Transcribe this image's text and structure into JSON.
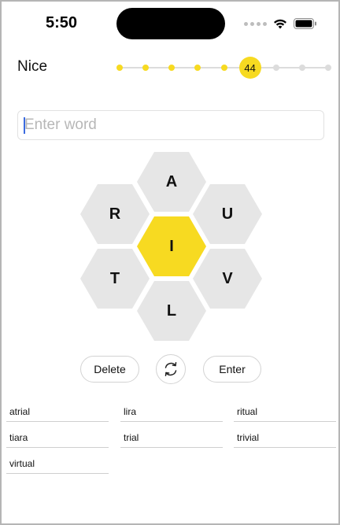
{
  "status_bar": {
    "time": "5:50"
  },
  "rank": {
    "label": "Nice",
    "score": "44",
    "filled_dots": 5,
    "empty_dots": 3,
    "colors": {
      "accent": "#f7da21",
      "inactive": "#dcdcdc"
    }
  },
  "input": {
    "value": "",
    "placeholder": "Enter word"
  },
  "hive": {
    "center": "I",
    "outer": [
      "A",
      "R",
      "U",
      "T",
      "V",
      "L"
    ]
  },
  "controls": {
    "delete_label": "Delete",
    "enter_label": "Enter",
    "shuffle_icon": "refresh-icon"
  },
  "found_words": [
    "atrial",
    "lira",
    "ritual",
    "tiara",
    "trial",
    "trivial",
    "virtual"
  ]
}
